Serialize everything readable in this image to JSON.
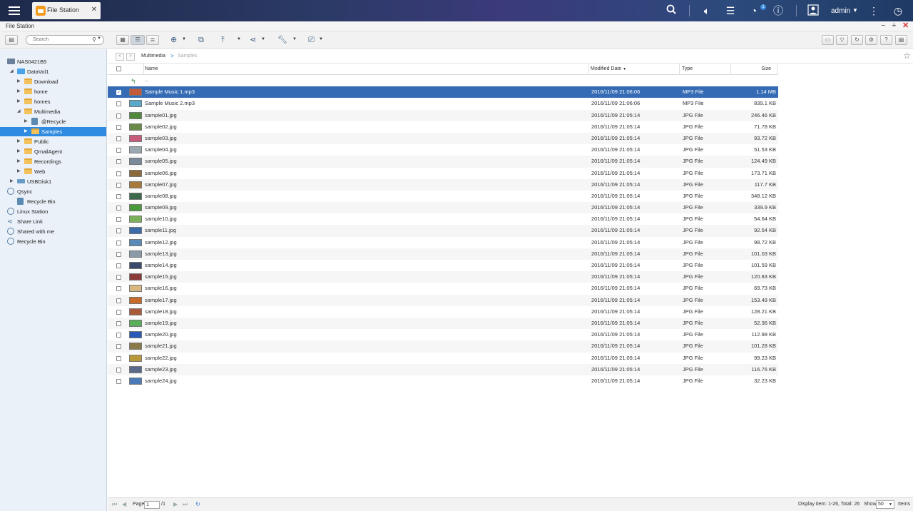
{
  "topbar": {
    "app_tab_label": "File Station",
    "user_name": "admin",
    "notification_count": "1"
  },
  "window": {
    "title": "File Station"
  },
  "search": {
    "placeholder": "Search"
  },
  "sidebar": {
    "root": "NAS0421B5",
    "volume": "DataVol1",
    "folders": [
      "Download",
      "home",
      "homes",
      "Multimedia",
      "@Recycle",
      "Samples",
      "Public",
      "QmailAgent",
      "Recordings",
      "Web"
    ],
    "usb": "USBDisk1",
    "qsync": "Qsync",
    "qsync_recycle": "Recycle Bin",
    "linux_station": "Linux Station",
    "share_link": "Share Link",
    "shared_with_me": "Shared with me",
    "recycle_bin": "Recycle Bin"
  },
  "breadcrumb": {
    "parent": "Multimedia",
    "separator": ">",
    "current": "Samples"
  },
  "columns": {
    "name": "Name",
    "modified": "Modified Date",
    "type": "Type",
    "size": "Size"
  },
  "up_row": "..",
  "files": [
    {
      "name": "Sample Music 1.mp3",
      "date": "2016/11/09 21:06:06",
      "type": "MP3 File",
      "size": "1.14 MB",
      "selected": true,
      "color": "#c25a3a"
    },
    {
      "name": "Sample Music 2.mp3",
      "date": "2016/11/09 21:06:06",
      "type": "MP3 File",
      "size": "839.1 KB",
      "color": "#5aa9c8"
    },
    {
      "name": "sample01.jpg",
      "date": "2016/11/09 21:05:14",
      "type": "JPG File",
      "size": "246.46 KB",
      "color": "#4f8a3a"
    },
    {
      "name": "sample02.jpg",
      "date": "2016/11/09 21:05:14",
      "type": "JPG File",
      "size": "71.78 KB",
      "color": "#6a8a4a"
    },
    {
      "name": "sample03.jpg",
      "date": "2016/11/09 21:05:14",
      "type": "JPG File",
      "size": "93.72 KB",
      "color": "#c85a7a"
    },
    {
      "name": "sample04.jpg",
      "date": "2016/11/09 21:05:14",
      "type": "JPG File",
      "size": "51.53 KB",
      "color": "#9aa8b0"
    },
    {
      "name": "sample05.jpg",
      "date": "2016/11/09 21:05:14",
      "type": "JPG File",
      "size": "124.49 KB",
      "color": "#7a8a9a"
    },
    {
      "name": "sample06.jpg",
      "date": "2016/11/09 21:05:14",
      "type": "JPG File",
      "size": "173.71 KB",
      "color": "#8a6a3a"
    },
    {
      "name": "sample07.jpg",
      "date": "2016/11/09 21:05:14",
      "type": "JPG File",
      "size": "117.7 KB",
      "color": "#a87a3a"
    },
    {
      "name": "sample08.jpg",
      "date": "2016/11/09 21:05:14",
      "type": "JPG File",
      "size": "348.12 KB",
      "color": "#3a6a4a"
    },
    {
      "name": "sample09.jpg",
      "date": "2016/11/09 21:05:14",
      "type": "JPG File",
      "size": "339.9 KB",
      "color": "#4a9a3a"
    },
    {
      "name": "sample10.jpg",
      "date": "2016/11/09 21:05:14",
      "type": "JPG File",
      "size": "54.64 KB",
      "color": "#7ab05a"
    },
    {
      "name": "sample11.jpg",
      "date": "2016/11/09 21:05:14",
      "type": "JPG File",
      "size": "92.54 KB",
      "color": "#3a6aa8"
    },
    {
      "name": "sample12.jpg",
      "date": "2016/11/09 21:05:14",
      "type": "JPG File",
      "size": "98.72 KB",
      "color": "#5a8ab8"
    },
    {
      "name": "sample13.jpg",
      "date": "2016/11/09 21:05:14",
      "type": "JPG File",
      "size": "101.03 KB",
      "color": "#8a9aa8"
    },
    {
      "name": "sample14.jpg",
      "date": "2016/11/09 21:05:14",
      "type": "JPG File",
      "size": "101.59 KB",
      "color": "#3a4a6a"
    },
    {
      "name": "sample15.jpg",
      "date": "2016/11/09 21:05:14",
      "type": "JPG File",
      "size": "120.83 KB",
      "color": "#8a3a3a"
    },
    {
      "name": "sample16.jpg",
      "date": "2016/11/09 21:05:14",
      "type": "JPG File",
      "size": "69.73 KB",
      "color": "#d8b880"
    },
    {
      "name": "sample17.jpg",
      "date": "2016/11/09 21:05:14",
      "type": "JPG File",
      "size": "153.49 KB",
      "color": "#c86a2a"
    },
    {
      "name": "sample18.jpg",
      "date": "2016/11/09 21:05:14",
      "type": "JPG File",
      "size": "128.21 KB",
      "color": "#a85a3a"
    },
    {
      "name": "sample19.jpg",
      "date": "2016/11/09 21:05:14",
      "type": "JPG File",
      "size": "52.36 KB",
      "color": "#5ab05a"
    },
    {
      "name": "sample20.jpg",
      "date": "2016/11/09 21:05:14",
      "type": "JPG File",
      "size": "112.98 KB",
      "color": "#2a5ab8"
    },
    {
      "name": "sample21.jpg",
      "date": "2016/11/09 21:05:14",
      "type": "JPG File",
      "size": "101.28 KB",
      "color": "#8a7a4a"
    },
    {
      "name": "sample22.jpg",
      "date": "2016/11/09 21:05:14",
      "type": "JPG File",
      "size": "99.23 KB",
      "color": "#b89a3a"
    },
    {
      "name": "sample23.jpg",
      "date": "2016/11/09 21:05:14",
      "type": "JPG File",
      "size": "116.76 KB",
      "color": "#5a6a8a"
    },
    {
      "name": "sample24.jpg",
      "date": "2016/11/09 21:05:14",
      "type": "JPG File",
      "size": "32.23 KB",
      "color": "#4a7ab8"
    }
  ],
  "footer": {
    "page_label": "Page",
    "page_value": "1",
    "page_total": "/1",
    "display_info": "Display item: 1-26, Total: 26",
    "show_label": "Show",
    "show_value": "50",
    "items_label": "Items"
  }
}
